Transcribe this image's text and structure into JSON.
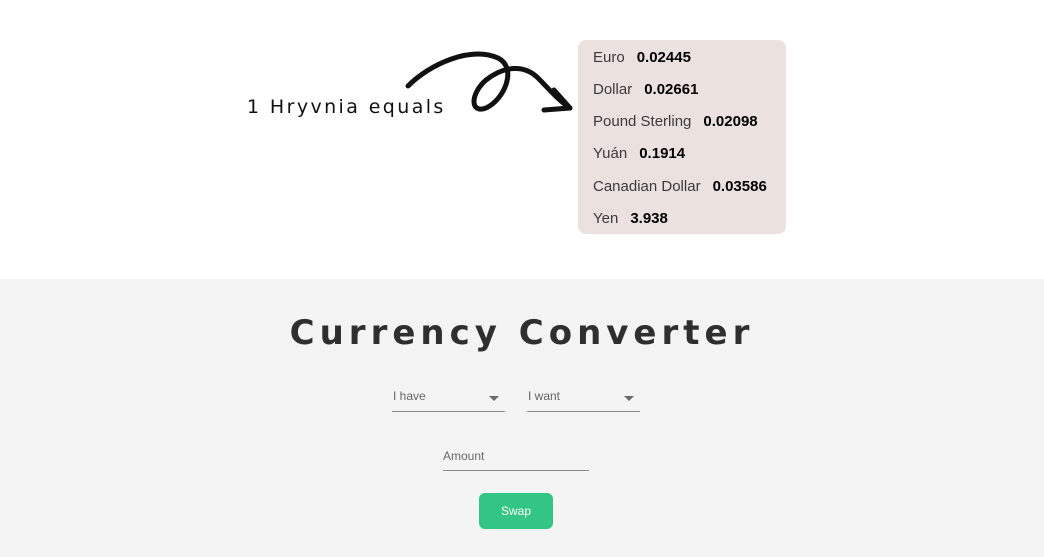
{
  "rates": {
    "intro": "1 Hryvnia equals",
    "items": [
      {
        "name": "Euro",
        "value": "0.02445"
      },
      {
        "name": "Dollar",
        "value": "0.02661"
      },
      {
        "name": "Pound Sterling",
        "value": "0.02098"
      },
      {
        "name": "Yuán",
        "value": "0.1914"
      },
      {
        "name": "Canadian Dollar",
        "value": "0.03586"
      },
      {
        "name": "Yen",
        "value": "3.938"
      }
    ]
  },
  "converter": {
    "title": "Currency Converter",
    "have_label": "I have",
    "want_label": "I want",
    "amount_placeholder": "Amount",
    "amount_value": "",
    "swap_label": "Swap"
  },
  "colors": {
    "card_bg": "#ebe2e0",
    "section_bg": "#f4f4f4",
    "button_bg": "#33c583"
  },
  "icons": {
    "arrow": "curved-arrow-icon",
    "caret": "caret-down-icon"
  }
}
